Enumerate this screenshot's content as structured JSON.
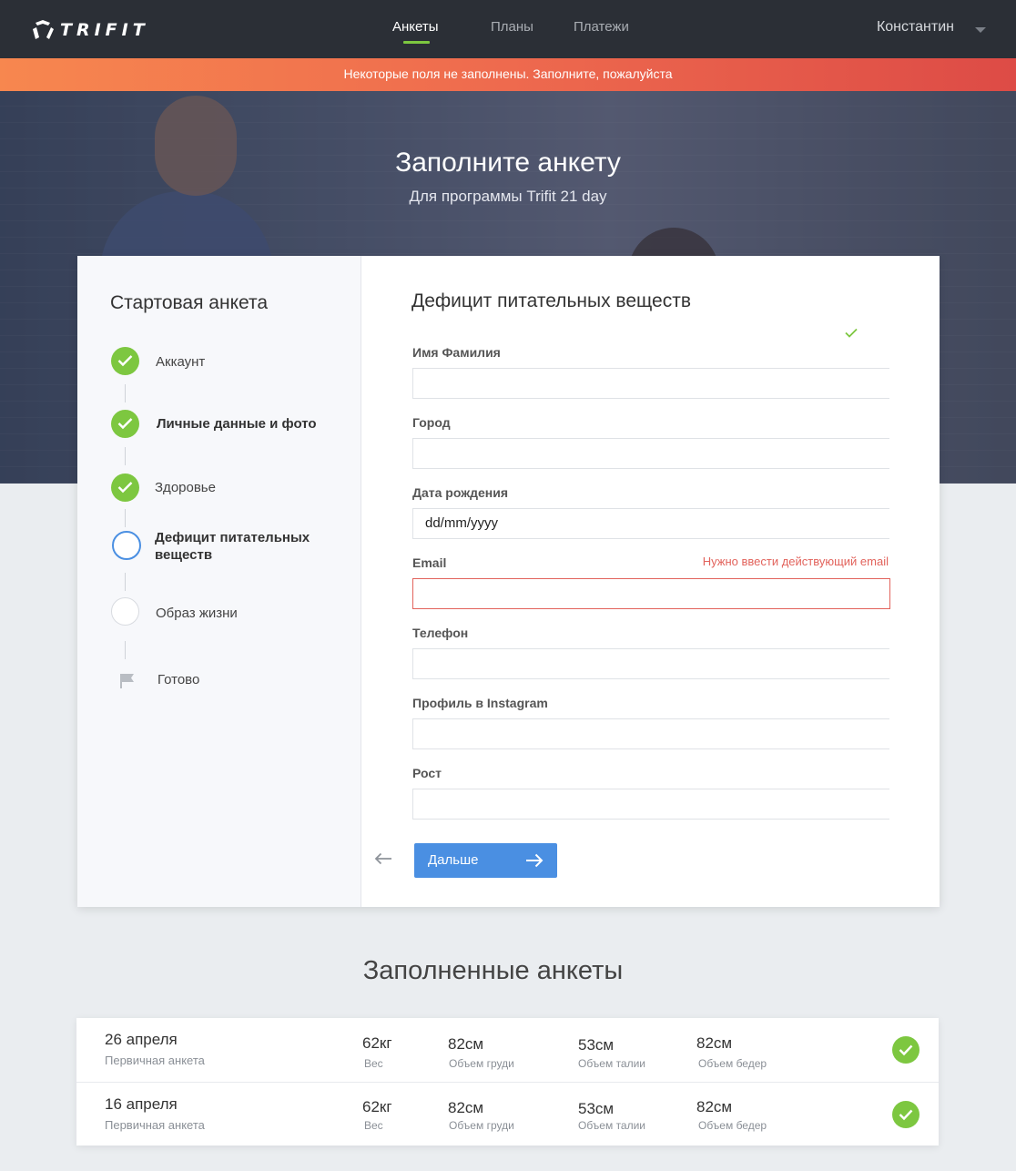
{
  "nav": {
    "logo_text": "TRIFIT",
    "tabs": [
      {
        "label": "Анкеты",
        "active": true
      },
      {
        "label": "Планы",
        "active": false
      },
      {
        "label": "Платежи",
        "active": false
      }
    ],
    "user_name": "Константин"
  },
  "warning": "Некоторые поля не заполнены. Заполните, пожалуйста",
  "hero": {
    "title": "Заполните анкету",
    "subtitle": "Для программы Trifit 21 day"
  },
  "sidebar": {
    "title": "Стартовая анкета",
    "steps": [
      {
        "label": "Аккаунт",
        "state": "done"
      },
      {
        "label": "Личные данные и фото",
        "state": "done"
      },
      {
        "label": "Здоровье",
        "state": "done"
      },
      {
        "label": "Дефицит питательных веществ",
        "state": "current"
      },
      {
        "label": "Образ жизни",
        "state": "todo"
      },
      {
        "label": "Готово",
        "state": "final"
      }
    ]
  },
  "form": {
    "title": "Дефицит питательных веществ",
    "fields": [
      {
        "label": "Имя Фамилия",
        "value": ""
      },
      {
        "label": "Город",
        "value": ""
      },
      {
        "label": "Дата рождения",
        "value": "dd/mm/yyyy"
      },
      {
        "label": "Email",
        "value": "",
        "error": "Нужно ввести действующий email"
      },
      {
        "label": "Телефон",
        "value": ""
      },
      {
        "label": "Профиль в Instagram",
        "value": ""
      },
      {
        "label": "Рост",
        "value": ""
      }
    ],
    "next_label": "Дальше"
  },
  "filled": {
    "title": "Заполненные анкеты",
    "rows": [
      {
        "date": "26 апреля",
        "type": "Первичная анкета",
        "weight": "62кг",
        "weight_cap": "Вес",
        "chest": "82см",
        "chest_cap": "Объем груди",
        "waist": "53см",
        "waist_cap": "Объем талии",
        "hips": "82см",
        "hips_cap": "Объем бедер"
      },
      {
        "date": "16 апреля",
        "type": "Первичная анкета",
        "weight": "62кг",
        "weight_cap": "Вес",
        "chest": "82см",
        "chest_cap": "Объем груди",
        "waist": "53см",
        "waist_cap": "Объем талии",
        "hips": "82см",
        "hips_cap": "Объем бедер"
      }
    ]
  },
  "colors": {
    "nav_bg": "#2b2f36",
    "accent_green": "#7dc740",
    "primary_blue": "#4a8fe2",
    "error_red": "#e2635c",
    "warning_orange": "#f7874f"
  },
  "icons": [
    "logo-mark-icon",
    "caret-down-icon",
    "check-icon",
    "flag-icon",
    "arrow-left-icon",
    "arrow-right-icon"
  ]
}
